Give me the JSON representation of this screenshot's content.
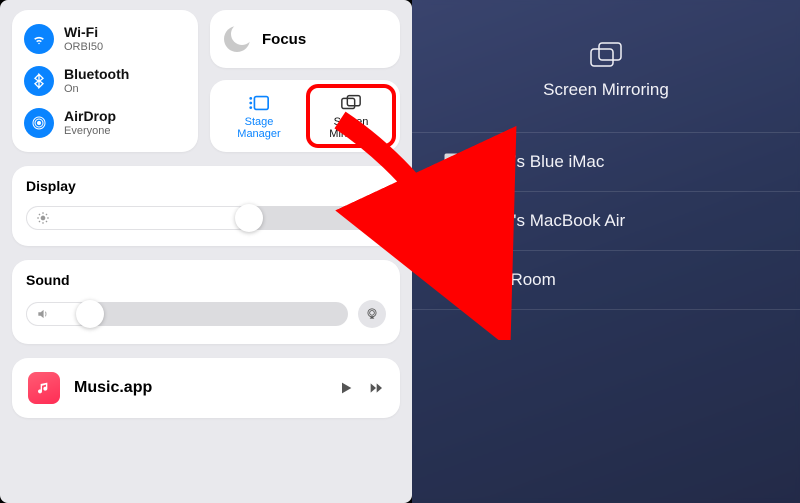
{
  "network": {
    "wifi": {
      "title": "Wi-Fi",
      "sub": "ORBI50"
    },
    "bluetooth": {
      "title": "Bluetooth",
      "sub": "On"
    },
    "airdrop": {
      "title": "AirDrop",
      "sub": "Everyone"
    }
  },
  "focus": {
    "label": "Focus"
  },
  "modules": {
    "stage_manager": {
      "label": "Stage Manager"
    },
    "screen_mirroring": {
      "label": "Screen Mirroring"
    }
  },
  "display": {
    "label": "Display",
    "value_pct": 62
  },
  "sound": {
    "label": "Sound",
    "value_pct": 20
  },
  "music": {
    "app": "Music.app"
  },
  "mirror_panel": {
    "title": "Screen Mirroring",
    "devices": [
      {
        "name": "Kirk's Blue iMac",
        "type": "imac"
      },
      {
        "name": "Kirk's MacBook Air",
        "type": "macbook"
      },
      {
        "name": "TV Room",
        "type": "appletv"
      }
    ]
  },
  "colors": {
    "accent": "#0a84ff",
    "highlight": "#ff0000"
  }
}
